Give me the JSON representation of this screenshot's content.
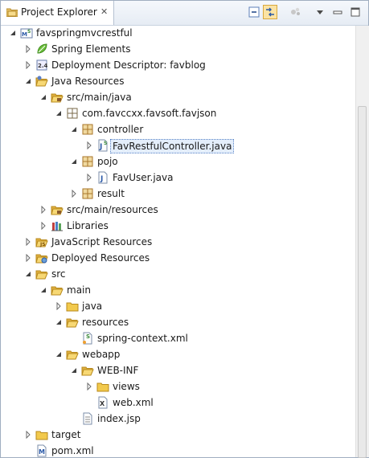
{
  "view": {
    "tab_title": "Project Explorer",
    "tab_close": "✕"
  },
  "toolbar": {
    "buttons": [
      {
        "name": "collapse-all-icon"
      },
      {
        "name": "link-with-editor-icon"
      },
      {
        "name": "view-menu-icon"
      },
      {
        "name": "minimize-icon"
      },
      {
        "name": "maximize-icon"
      }
    ]
  },
  "tree": [
    {
      "label": "favspringmvcrestful",
      "depth": 0,
      "expander": "expanded",
      "icon": "maven-project"
    },
    {
      "label": "Spring Elements",
      "depth": 1,
      "expander": "collapsed",
      "icon": "spring-leaf"
    },
    {
      "label": "Deployment Descriptor: favblog",
      "depth": 1,
      "expander": "collapsed",
      "icon": "deployment-descriptor"
    },
    {
      "label": "Java Resources",
      "depth": 1,
      "expander": "expanded",
      "icon": "java-resources"
    },
    {
      "label": "src/main/java",
      "depth": 2,
      "expander": "expanded",
      "icon": "source-folder"
    },
    {
      "label": "com.favccxx.favsoft.favjson",
      "depth": 3,
      "expander": "expanded",
      "icon": "package-empty"
    },
    {
      "label": "controller",
      "depth": 4,
      "expander": "expanded",
      "icon": "package"
    },
    {
      "label": "FavRestfulController.java",
      "depth": 5,
      "expander": "collapsed",
      "icon": "java-file-spring",
      "selected": true
    },
    {
      "label": "pojo",
      "depth": 4,
      "expander": "expanded",
      "icon": "package"
    },
    {
      "label": "FavUser.java",
      "depth": 5,
      "expander": "collapsed",
      "icon": "java-file"
    },
    {
      "label": "result",
      "depth": 4,
      "expander": "collapsed",
      "icon": "package"
    },
    {
      "label": "src/main/resources",
      "depth": 2,
      "expander": "collapsed",
      "icon": "source-folder"
    },
    {
      "label": "Libraries",
      "depth": 2,
      "expander": "collapsed",
      "icon": "libraries"
    },
    {
      "label": "JavaScript Resources",
      "depth": 1,
      "expander": "collapsed",
      "icon": "javascript-resources"
    },
    {
      "label": "Deployed Resources",
      "depth": 1,
      "expander": "collapsed",
      "icon": "deployed-resources"
    },
    {
      "label": "src",
      "depth": 1,
      "expander": "expanded",
      "icon": "folder-open"
    },
    {
      "label": "main",
      "depth": 2,
      "expander": "expanded",
      "icon": "folder-open"
    },
    {
      "label": "java",
      "depth": 3,
      "expander": "collapsed",
      "icon": "folder"
    },
    {
      "label": "resources",
      "depth": 3,
      "expander": "expanded",
      "icon": "folder-open"
    },
    {
      "label": "spring-context.xml",
      "depth": 4,
      "expander": "none",
      "icon": "spring-xml-file"
    },
    {
      "label": "webapp",
      "depth": 3,
      "expander": "expanded",
      "icon": "folder-open"
    },
    {
      "label": "WEB-INF",
      "depth": 4,
      "expander": "expanded",
      "icon": "folder-open"
    },
    {
      "label": "views",
      "depth": 5,
      "expander": "collapsed",
      "icon": "folder"
    },
    {
      "label": "web.xml",
      "depth": 5,
      "expander": "none",
      "icon": "xml-file"
    },
    {
      "label": "index.jsp",
      "depth": 4,
      "expander": "none",
      "icon": "jsp-file"
    },
    {
      "label": "target",
      "depth": 1,
      "expander": "collapsed",
      "icon": "folder"
    },
    {
      "label": "pom.xml",
      "depth": 1,
      "expander": "none",
      "icon": "maven-pom-file"
    }
  ]
}
